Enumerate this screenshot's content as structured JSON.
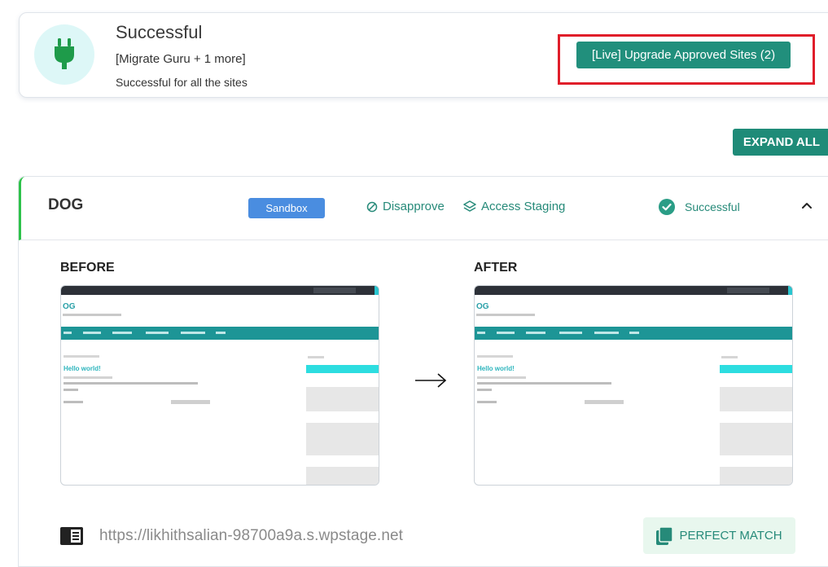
{
  "top_card": {
    "title": "Successful",
    "plugins": "[Migrate Guru + 1 more]",
    "description": "Successful for all the sites",
    "upgrade_button": "[Live] Upgrade Approved Sites (2)"
  },
  "expand_all_label": "EXPAND ALL",
  "site": {
    "name": "DOG",
    "environment_badge": "Sandbox",
    "disapprove_label": "Disapprove",
    "access_staging_label": "Access Staging",
    "status": "Successful",
    "before_label": "BEFORE",
    "after_label": "AFTER",
    "url": "https://likhithsalian-98700a9a.s.wpstage.net",
    "match_label": "PERFECT MATCH"
  },
  "colors": {
    "accent": "#218f7c",
    "sandbox": "#4a8de0",
    "highlight": "#e01e2a",
    "success_border": "#2ec24a"
  }
}
